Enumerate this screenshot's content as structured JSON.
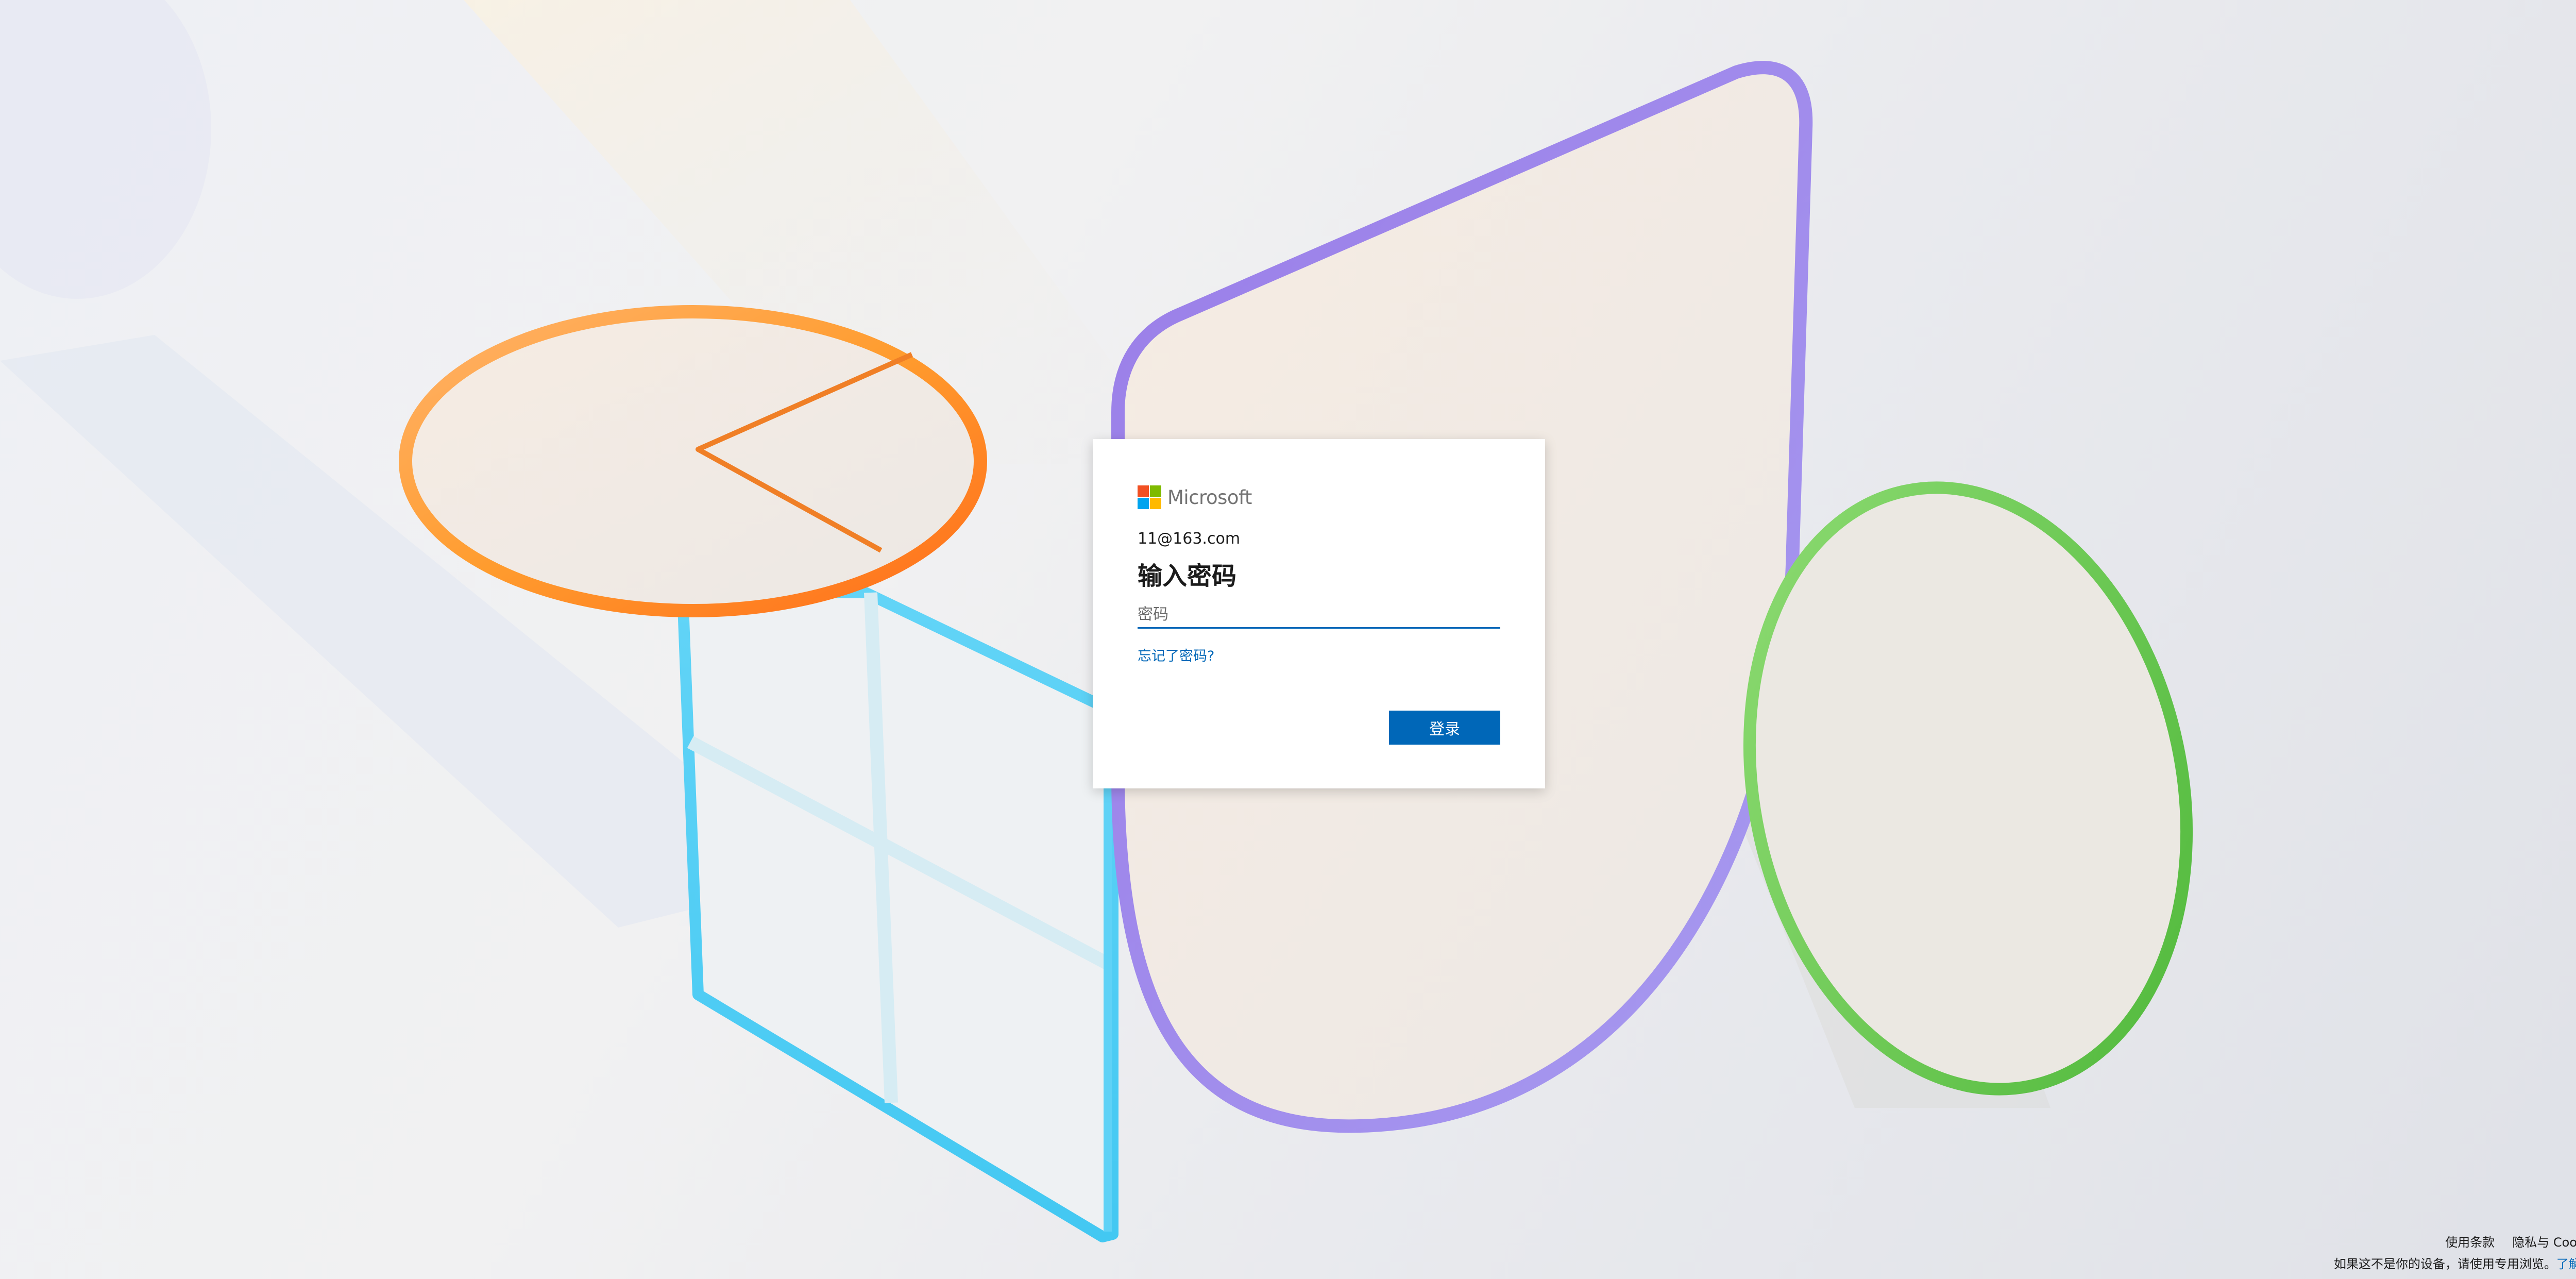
{
  "brand": {
    "name": "Microsoft",
    "colors": [
      "#f25022",
      "#7fba00",
      "#00a4ef",
      "#ffb900"
    ]
  },
  "login": {
    "identity": "11@163.com",
    "title": "输入密码",
    "password_placeholder": "密码",
    "forgot_link": "忘记了密码?",
    "signin_label": "登录"
  },
  "footer": {
    "terms": "使用条款",
    "privacy": "隐私与 Cookie",
    "more": "...",
    "notice": "如果这不是你的设备，请使用专用浏览。",
    "learn_more": "了解详细信息"
  },
  "colors": {
    "accent": "#0067b8",
    "text": "#1b1b1b"
  }
}
